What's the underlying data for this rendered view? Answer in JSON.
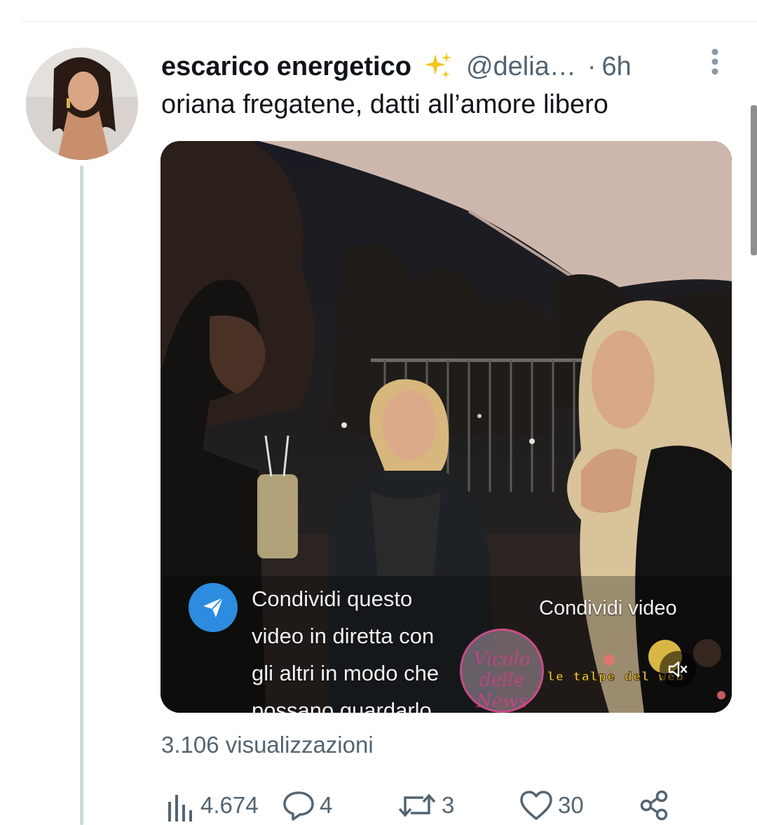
{
  "tweet": {
    "display_name": "escarico energetico",
    "name_emoji_icon": "sparkles-icon",
    "handle": "@delia…",
    "separator": "·",
    "time": "6h",
    "text": "oriana fregatene, datti all’amore libero",
    "views": "3.106 visualizzazioni"
  },
  "media": {
    "share_caption_lines": [
      "Condividi questo",
      "video in diretta con",
      "gli altri in modo che",
      "possano guardarlo"
    ],
    "share_video_label": "Condividi video",
    "watermark_text": "le talpe del web",
    "stamp_text": "Vicolo delle News",
    "mute_icon": "volume-muted-icon"
  },
  "actions": {
    "views_count": "4.674",
    "replies_count": "4",
    "retweets_count": "3",
    "likes_count": "30"
  },
  "colors": {
    "text_primary": "#0f1419",
    "text_secondary": "#536471",
    "thread_line": "#cfd9de",
    "share_blue": "#2d8be0"
  }
}
